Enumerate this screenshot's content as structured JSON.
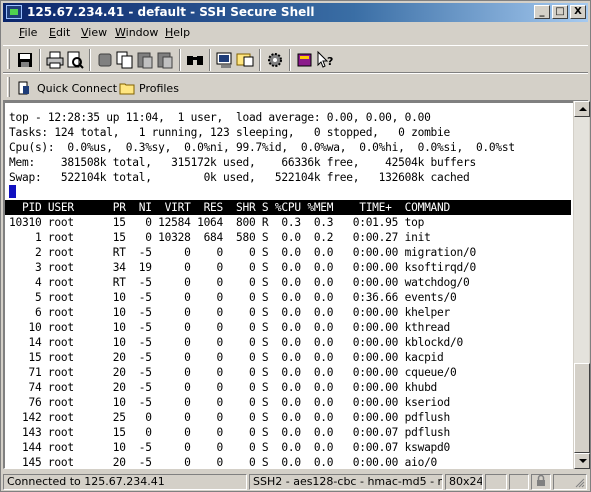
{
  "window": {
    "title": "125.67.234.41 - default - SSH Secure Shell",
    "controls": {
      "minimize": "_",
      "maximize": "□",
      "close": "X"
    }
  },
  "menu": [
    "File",
    "Edit",
    "View",
    "Window",
    "Help"
  ],
  "toolbar": {
    "icons": [
      "save-icon",
      "print-icon",
      "print-preview-icon",
      "stop-icon",
      "copy-icon",
      "paste-icon",
      "paste-special-icon",
      "find-icon",
      "new-terminal-icon",
      "new-file-transfer-icon",
      "settings-icon",
      "help-book-icon",
      "context-help-icon"
    ]
  },
  "profiles_bar": {
    "quick_connect": "Quick Connect",
    "profiles": "Profiles"
  },
  "terminal": {
    "summary": [
      "top - 12:28:35 up 11:04,  1 user,  load average: 0.00, 0.00, 0.00",
      "Tasks: 124 total,   1 running, 123 sleeping,   0 stopped,   0 zombie",
      "Cpu(s):  0.0%us,  0.3%sy,  0.0%ni, 99.7%id,  0.0%wa,  0.0%hi,  0.0%si,  0.0%st",
      "Mem:    381508k total,   315172k used,    66336k free,    42504k buffers",
      "Swap:   522104k total,        0k used,   522104k free,   132608k cached"
    ],
    "header": "  PID USER      PR  NI  VIRT  RES  SHR S %CPU %MEM    TIME+  COMMAND",
    "processes": [
      "10310 root      15   0 12584 1064  800 R  0.3  0.3   0:01.95 top",
      "    1 root      15   0 10328  684  580 S  0.0  0.2   0:00.27 init",
      "    2 root      RT  -5     0    0    0 S  0.0  0.0   0:00.00 migration/0",
      "    3 root      34  19     0    0    0 S  0.0  0.0   0:00.00 ksoftirqd/0",
      "    4 root      RT  -5     0    0    0 S  0.0  0.0   0:00.00 watchdog/0",
      "    5 root      10  -5     0    0    0 S  0.0  0.0   0:36.66 events/0",
      "    6 root      10  -5     0    0    0 S  0.0  0.0   0:00.00 khelper",
      "   10 root      10  -5     0    0    0 S  0.0  0.0   0:00.00 kthread",
      "   14 root      10  -5     0    0    0 S  0.0  0.0   0:00.00 kblockd/0",
      "   15 root      20  -5     0    0    0 S  0.0  0.0   0:00.00 kacpid",
      "   71 root      20  -5     0    0    0 S  0.0  0.0   0:00.00 cqueue/0",
      "   74 root      20  -5     0    0    0 S  0.0  0.0   0:00.00 khubd",
      "   76 root      10  -5     0    0    0 S  0.0  0.0   0:00.00 kseriod",
      "  142 root      25   0     0    0    0 S  0.0  0.0   0:00.00 pdflush",
      "  143 root      15   0     0    0    0 S  0.0  0.0   0:00.07 pdflush",
      "  144 root      10  -5     0    0    0 S  0.0  0.0   0:00.07 kswapd0",
      "  145 root      20  -5     0    0    0 S  0.0  0.0   0:00.00 aio/0"
    ]
  },
  "statusbar": {
    "connection": "Connected to 125.67.234.41",
    "cipher": "SSH2 - aes128-cbc - hmac-md5 - none",
    "size": "80x24"
  }
}
